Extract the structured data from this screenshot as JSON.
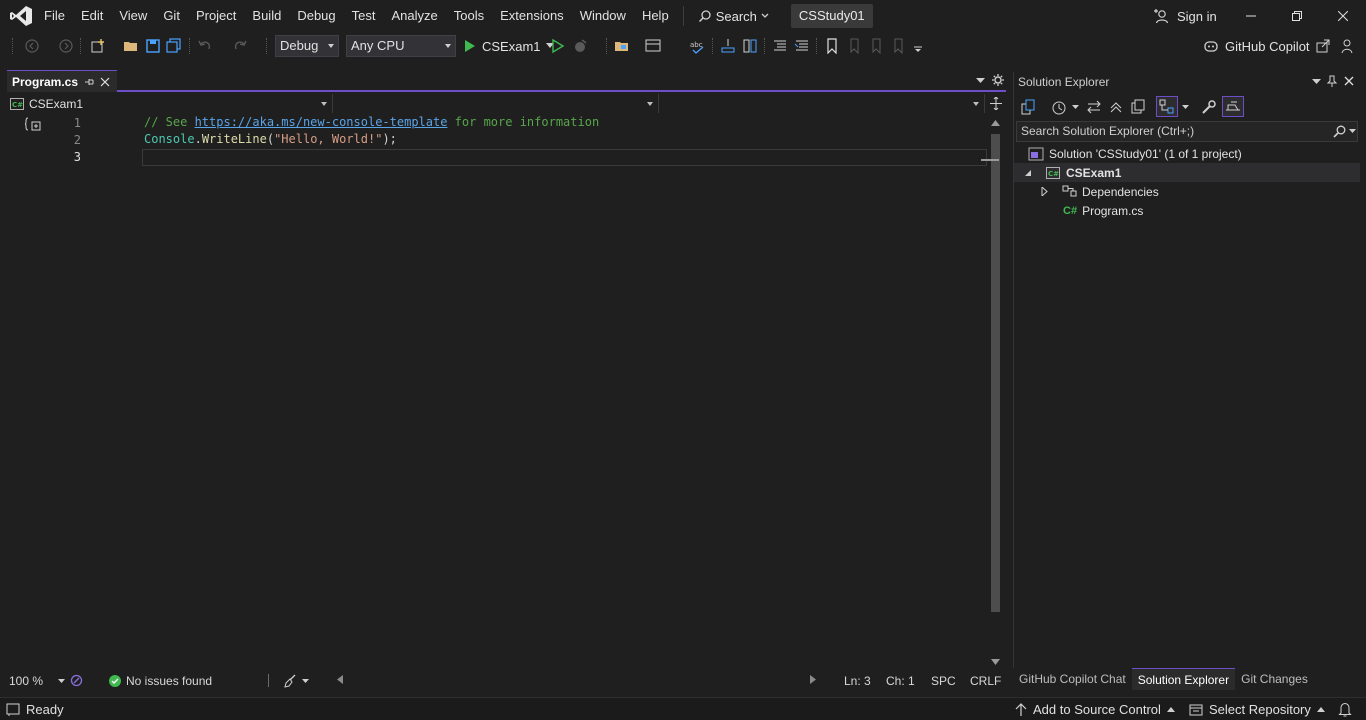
{
  "menubar": {
    "items": [
      "File",
      "Edit",
      "View",
      "Git",
      "Project",
      "Build",
      "Debug",
      "Test",
      "Analyze",
      "Tools",
      "Extensions",
      "Window",
      "Help"
    ],
    "search_label": "Search",
    "solution_title": "CSStudy01",
    "signin_label": "Sign in"
  },
  "toolbar": {
    "config": "Debug",
    "platform": "Any CPU",
    "run_target": "CSExam1",
    "copilot_label": "GitHub Copilot"
  },
  "editor": {
    "tab_label": "Program.cs",
    "nav_project": "CSExam1",
    "line_numbers": [
      "1",
      "2",
      "3"
    ],
    "line1": {
      "comment_prefix": "// See ",
      "link": "https://aka.ms/new-console-template",
      "comment_suffix": " for more information"
    },
    "line2": {
      "type": "Console",
      "dot": ".",
      "method": "WriteLine",
      "open": "(",
      "string": "\"Hello, World!\"",
      "close": ");"
    }
  },
  "editor_status": {
    "zoom": "100 %",
    "issues": "No issues found",
    "line": "Ln: 3",
    "col": "Ch: 1",
    "whitespace": "SPC",
    "line_ending": "CRLF"
  },
  "solution_explorer": {
    "title": "Solution Explorer",
    "search_placeholder": "Search Solution Explorer (Ctrl+;)",
    "solution_node": "Solution 'CSStudy01' (1 of 1 project)",
    "project_node": "CSExam1",
    "dependencies_node": "Dependencies",
    "file_node": "Program.cs",
    "file_badge": "C#",
    "bottom_tabs": [
      "GitHub Copilot Chat",
      "Solution Explorer",
      "Git Changes"
    ]
  },
  "statusbar": {
    "ready": "Ready",
    "source_control": "Add to Source Control",
    "select_repo": "Select Repository"
  },
  "colors": {
    "accent": "#6d4ec7",
    "background": "#1f1f1f",
    "comment": "#57a64a",
    "link": "#5aa4e8",
    "type": "#4ec9b0",
    "method": "#dcdcaa",
    "string": "#d69d85"
  }
}
